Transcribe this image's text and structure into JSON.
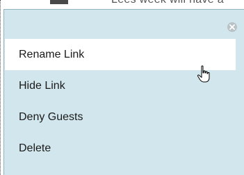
{
  "background": {
    "partial_text": "Lees week will have a"
  },
  "menu": {
    "close_icon": "close-circle-icon",
    "items": [
      {
        "label": "Rename Link",
        "active": true
      },
      {
        "label": "Hide Link",
        "active": false
      },
      {
        "label": "Deny Guests",
        "active": false
      },
      {
        "label": "Delete",
        "active": false
      }
    ]
  },
  "colors": {
    "menu_bg": "#d2e7ed",
    "menu_border": "#8fb3bf",
    "active_item_bg": "#ffffff",
    "close_icon_bg": "#b9c3c7"
  },
  "cursor": "hand-pointer-icon"
}
